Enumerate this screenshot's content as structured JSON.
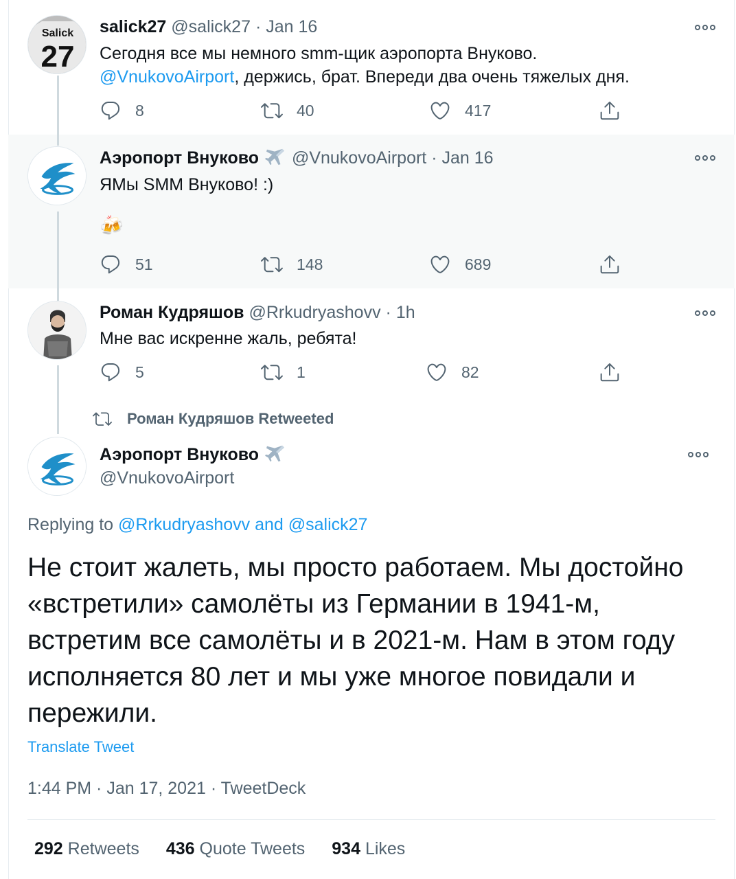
{
  "tweets": [
    {
      "name": "salick27",
      "handle": "@salick27",
      "sep": "·",
      "date": "Jan 16",
      "line1": "Сегодня все мы немного smm-щик аэропорта Внуково.",
      "mention": "@VnukovoAirport",
      "line2": ", держись, брат. Впереди два очень тяжелых дня.",
      "replies": "8",
      "retweets": "40",
      "likes": "417"
    },
    {
      "name": "Аэропорт Внуково",
      "handle": "@VnukovoAirport",
      "sep": "·",
      "date": "Jan 16",
      "text": "ЯМы SMM Внуково! :)",
      "emoji": "🍻",
      "replies": "51",
      "retweets": "148",
      "likes": "689"
    },
    {
      "name": "Роман Кудряшов",
      "handle": "@Rrkudryashovv",
      "sep": "·",
      "date": "1h",
      "text": "Мне вас искренне жаль, ребята!",
      "replies": "5",
      "retweets": "1",
      "likes": "82"
    }
  ],
  "retweeted_label": "Роман Кудряшов Retweeted",
  "main": {
    "name": "Аэропорт Внуково",
    "handle": "@VnukovoAirport",
    "replying_prefix": "Replying to ",
    "replying_user1": "@Rrkudryashovv",
    "replying_and": " and ",
    "replying_user2": "@salick27",
    "text_lines": [
      "Не стоит жалеть, мы просто работаем. Мы достойно",
      "«встретили» самолёты из Германии в 1941-м,",
      "встретим все самолёты и в 2021-м. Нам в этом году",
      "исполняется 80 лет и мы уже многое повидали и",
      "пережили."
    ],
    "translate": "Translate Tweet",
    "meta": "1:44 PM · Jan 17, 2021 · TweetDeck",
    "stats": {
      "retweets_count": "292",
      "retweets_label": "Retweets",
      "quotes_count": "436",
      "quotes_label": "Quote Tweets",
      "likes_count": "934",
      "likes_label": "Likes"
    }
  },
  "avatar_text": {
    "salick_top": "Salick",
    "salick_num": "27"
  },
  "icons": {
    "reply": "reply-icon",
    "retweet": "retweet-icon",
    "like": "heart-icon",
    "share": "share-icon",
    "more": "more-icon",
    "plane": "airplane-emoji-icon"
  },
  "colors": {
    "link": "#1d9bf0",
    "secondary": "#536471",
    "highlight_bg": "#f7f9f9"
  }
}
